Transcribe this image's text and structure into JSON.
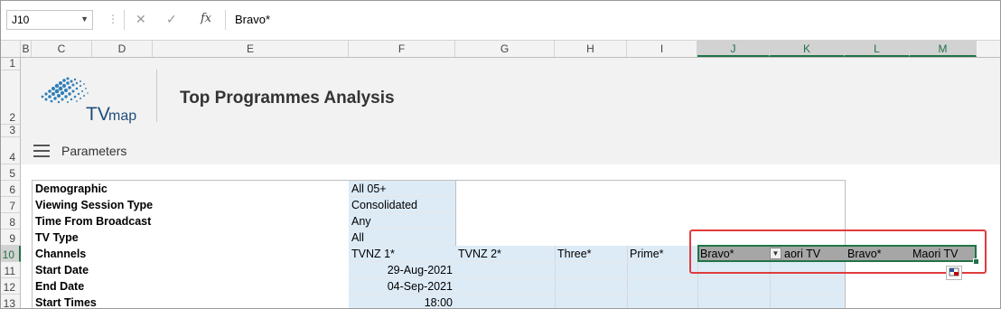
{
  "formula_bar": {
    "name_box": "J10",
    "cancel_glyph": "✕",
    "enter_glyph": "✓",
    "fx_label": "fx",
    "value": "Bravo*"
  },
  "columns": [
    "B",
    "C",
    "D",
    "E",
    "F",
    "G",
    "H",
    "I",
    "J",
    "K",
    "L",
    "M"
  ],
  "rows": [
    "1",
    "2",
    "3",
    "4",
    "5",
    "6",
    "7",
    "8",
    "9",
    "10",
    "11",
    "12",
    "13"
  ],
  "header": {
    "logo_text_tv": "TV",
    "logo_text_map": "map",
    "title": "Top Programmes Analysis"
  },
  "parameters": {
    "heading": "Parameters",
    "labels": [
      "Demographic",
      "Viewing Session Type",
      "Time From Broadcast",
      "TV Type",
      "Channels",
      "Start Date",
      "End Date",
      "Start Times"
    ],
    "values": {
      "demographic": "All 05+",
      "viewing_session_type": "Consolidated",
      "time_from_broadcast": "Any",
      "tv_type": "All",
      "start_date": "29-Aug-2021",
      "end_date": "04-Sep-2021",
      "start_time": "18:00"
    },
    "channels": [
      "TVNZ 1*",
      "TVNZ 2*",
      "Three*",
      "Prime*"
    ],
    "channels_selected": {
      "j": "Bravo*",
      "k": "aori TV",
      "l": "Bravo*",
      "m": "Maori TV"
    }
  },
  "colors": {
    "accent": "#217346",
    "highlight": "#e03c3c",
    "input_fill": "#ddebf7",
    "selected_fill": "#a6a6a6"
  }
}
